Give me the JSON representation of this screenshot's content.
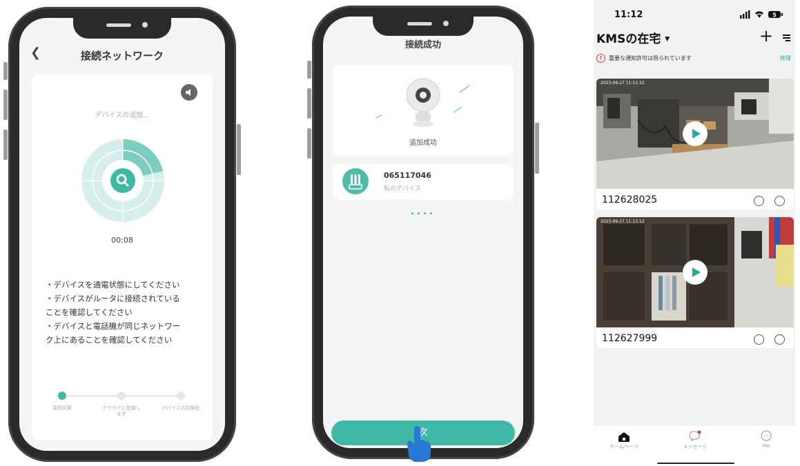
{
  "phone1": {
    "title": "接続ネットワーク",
    "back_icon": "chevron-left-icon",
    "sound_icon": "speaker-icon",
    "status": "デバイスの追加...",
    "search_icon": "search-icon",
    "timer": "00:08",
    "tips": [
      "・デバイスを通電状態にしてください",
      "・デバイスがルータに接続されている",
      "ことを確認してください",
      "・デバイスと電話機が同じネットワー",
      "ク上にあることを確認してください"
    ],
    "steps": [
      {
        "label": "接続試案"
      },
      {
        "label": "クラウドに登録します"
      },
      {
        "label": "デバイスの初期化"
      }
    ],
    "accent": "#3fb8a6"
  },
  "phone2": {
    "title": "接続成功",
    "success_label": "追加成功",
    "device_id": "065117046",
    "device_name": "私のデバイス",
    "next_label": "次"
  },
  "phone3": {
    "time": "11:12",
    "home_title": "KMSの在宅",
    "warning_text": "重要な通知許可は限られています",
    "fix_label": "修理",
    "cameras": [
      {
        "name": "112628025",
        "timestamp": "2023-09-27 11:11:12"
      },
      {
        "name": "112627999",
        "timestamp": "2023-09-27 11:11:12"
      }
    ],
    "tabs": [
      {
        "label": "ホームページ",
        "icon": "home-icon"
      },
      {
        "label": "メッセージ",
        "icon": "message-icon"
      },
      {
        "label": "Me",
        "icon": "profile-icon"
      }
    ],
    "accent": "#2ba79a",
    "warning_color": "#e53935"
  }
}
